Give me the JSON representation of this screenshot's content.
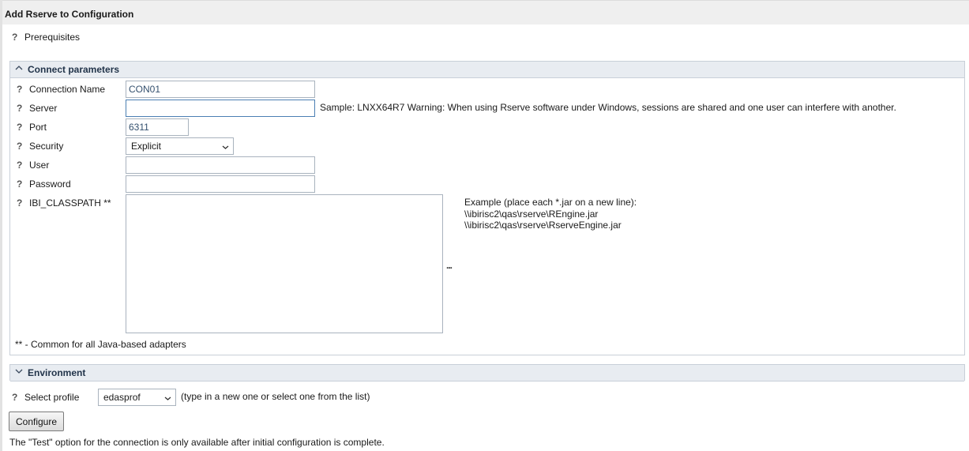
{
  "window": {
    "title": "Add Rserve to Configuration"
  },
  "prerequisites": {
    "label": "Prerequisites"
  },
  "connect": {
    "header": "Connect parameters",
    "connection_name": {
      "label": "Connection Name",
      "value": "CON01"
    },
    "server": {
      "label": "Server",
      "value": "",
      "hint": "Sample: LNXX64R7 Warning: When using Rserve software under Windows, sessions are shared and one user can interfere with another."
    },
    "port": {
      "label": "Port",
      "value": "6311"
    },
    "security": {
      "label": "Security",
      "value": "Explicit"
    },
    "user": {
      "label": "User",
      "value": ""
    },
    "password": {
      "label": "Password",
      "value": ""
    },
    "classpath": {
      "label": "IBI_CLASSPATH **",
      "value": "",
      "example_lines": [
        "Example (place each *.jar on a new line):",
        "\\\\ibirisc2\\qas\\rserve\\REngine.jar",
        "\\\\ibirisc2\\qas\\rserve\\RserveEngine.jar"
      ],
      "browse": "..."
    },
    "footnote": "** - Common for all Java-based adapters"
  },
  "environment": {
    "header": "Environment",
    "profile": {
      "label": "Select profile",
      "value": "edasprof",
      "hint": "(type in a new one or select one from the list)"
    }
  },
  "actions": {
    "configure": "Configure"
  },
  "note": "The \"Test\" option for the connection is only available after initial configuration is complete.",
  "icons": {
    "help": "?",
    "collapse": "^",
    "expand": "v"
  }
}
